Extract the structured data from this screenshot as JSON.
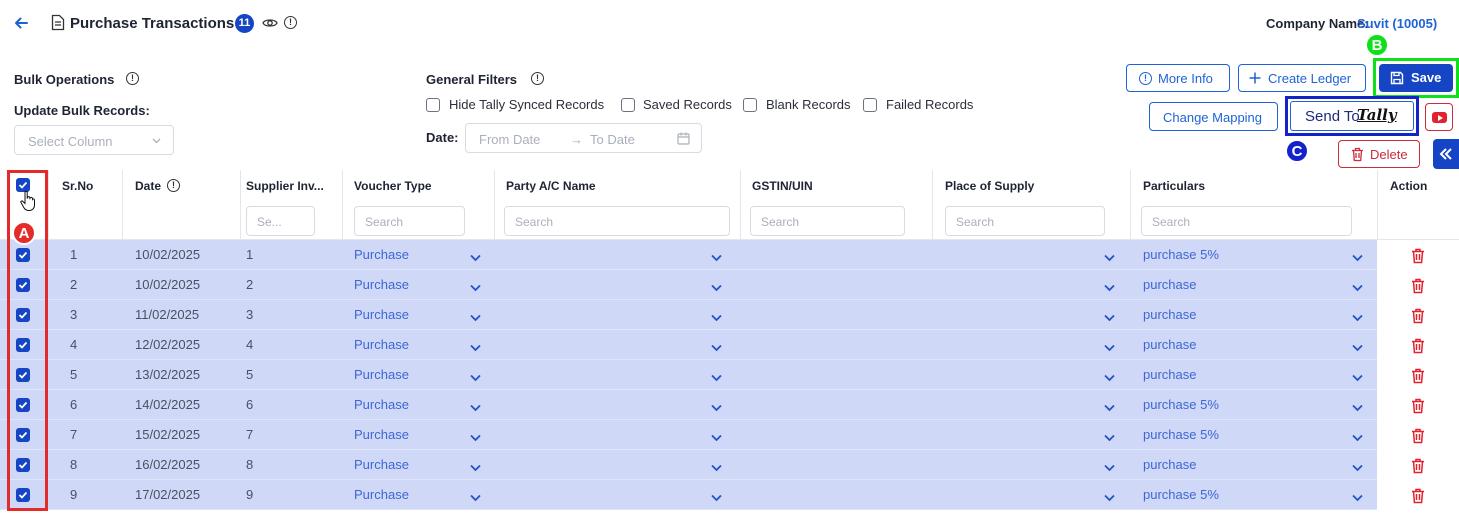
{
  "header": {
    "title": "Purchase Transactions",
    "count": "11",
    "company_label": "Company Name:",
    "company_name": "Suvit (10005)"
  },
  "bulk": {
    "title": "Bulk Operations",
    "update_label": "Update Bulk Records:",
    "select_placeholder": "Select Column"
  },
  "filters": {
    "title": "General Filters",
    "options": [
      "Hide Tally Synced Records",
      "Saved Records",
      "Blank Records",
      "Failed Records"
    ],
    "date_label": "Date:",
    "from_placeholder": "From Date",
    "arrow": "→",
    "to_placeholder": "To Date"
  },
  "actions": {
    "more_info": "More Info",
    "create_ledger": "Create Ledger",
    "save": "Save",
    "change_mapping": "Change Mapping",
    "send_to": "Send To",
    "send_to_brand": "Tally",
    "delete": "Delete"
  },
  "markers": {
    "a": "A",
    "b": "B",
    "c": "C"
  },
  "colors": {
    "primary": "#1545c4",
    "link": "#1e63d6",
    "row_selected": "#cfd8f7",
    "danger": "#e0232e",
    "marker_a": "#e32b2b",
    "marker_b": "#0fe01b",
    "marker_c": "#1422cc"
  },
  "table": {
    "columns": [
      "Sr.No",
      "Date",
      "Supplier Inv...",
      "Voucher Type",
      "Party A/C Name",
      "GSTIN/UIN",
      "Place of Supply",
      "Particulars",
      "Action"
    ],
    "search_placeholders": {
      "supplier": "Se...",
      "default": "Search"
    },
    "rows": [
      {
        "sr": "1",
        "date": "10/02/2025",
        "inv": "1",
        "voucher": "Purchase",
        "particulars": "purchase 5%"
      },
      {
        "sr": "2",
        "date": "10/02/2025",
        "inv": "2",
        "voucher": "Purchase",
        "particulars": "purchase"
      },
      {
        "sr": "3",
        "date": "11/02/2025",
        "inv": "3",
        "voucher": "Purchase",
        "particulars": "purchase"
      },
      {
        "sr": "4",
        "date": "12/02/2025",
        "inv": "4",
        "voucher": "Purchase",
        "particulars": "purchase"
      },
      {
        "sr": "5",
        "date": "13/02/2025",
        "inv": "5",
        "voucher": "Purchase",
        "particulars": "purchase"
      },
      {
        "sr": "6",
        "date": "14/02/2025",
        "inv": "6",
        "voucher": "Purchase",
        "particulars": "purchase 5%"
      },
      {
        "sr": "7",
        "date": "15/02/2025",
        "inv": "7",
        "voucher": "Purchase",
        "particulars": "purchase 5%"
      },
      {
        "sr": "8",
        "date": "16/02/2025",
        "inv": "8",
        "voucher": "Purchase",
        "particulars": "purchase"
      },
      {
        "sr": "9",
        "date": "17/02/2025",
        "inv": "9",
        "voucher": "Purchase",
        "particulars": "purchase 5%"
      }
    ]
  }
}
